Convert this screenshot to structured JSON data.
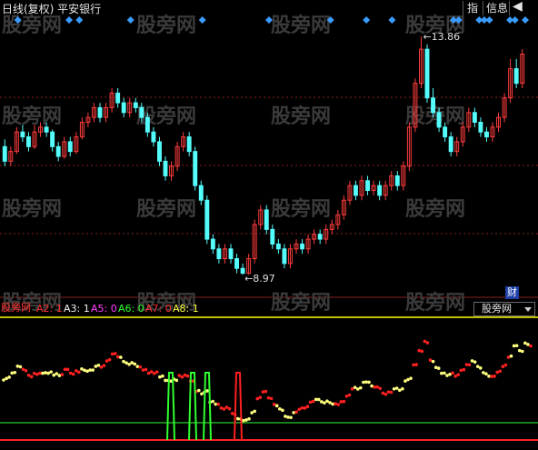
{
  "title": "日线(复权)  平安银行",
  "toolbar": {
    "zhi": "指",
    "xinxi": "信息",
    "back": "◀"
  },
  "watermark": "股旁网",
  "cai_badge": "财",
  "indicator": {
    "name": "股旁网",
    "selector": "股旁网",
    "labels": [
      {
        "key": "A2",
        "value": "1",
        "color": "#ff3030"
      },
      {
        "key": "A3",
        "value": "1",
        "color": "#f2f2f2"
      },
      {
        "key": "A5",
        "value": "0",
        "color": "#ff40ff"
      },
      {
        "key": "A6",
        "value": "0",
        "color": "#30ff30"
      },
      {
        "key": "A7",
        "value": "0",
        "color": "#ff3030"
      },
      {
        "key": "A8",
        "value": "1",
        "color": "#ffff40"
      }
    ]
  },
  "colors": {
    "up": "#ff3c3c",
    "down": "#54fcfc",
    "grid": "#8a1f1f",
    "diamond": "#3a9cff",
    "yellow_line": "#ffff00",
    "red_line": "#ff2020",
    "green_spike": "#30ff30",
    "red_spike": "#ff2020",
    "dot_red": "#ff2020",
    "dot_yellow": "#ffff80"
  },
  "chart_data": {
    "type": "candlestick",
    "high_label": "13.86",
    "low_label": "8.97",
    "high_value": 13.86,
    "low_value": 8.97,
    "price_range": [
      8.6,
      14.2
    ],
    "candles": [
      [
        11.6,
        11.3,
        11.75,
        11.2
      ],
      [
        11.3,
        11.5,
        11.6,
        11.2
      ],
      [
        11.5,
        11.9,
        12.0,
        11.45
      ],
      [
        11.9,
        11.8,
        12.05,
        11.7
      ],
      [
        11.8,
        11.6,
        11.9,
        11.5
      ],
      [
        11.6,
        11.9,
        12.05,
        11.55
      ],
      [
        11.9,
        12.0,
        12.1,
        11.8
      ],
      [
        12.0,
        11.9,
        12.1,
        11.8
      ],
      [
        11.9,
        11.6,
        11.95,
        11.5
      ],
      [
        11.6,
        11.4,
        11.7,
        11.3
      ],
      [
        11.4,
        11.7,
        11.8,
        11.35
      ],
      [
        11.7,
        11.5,
        11.8,
        11.4
      ],
      [
        11.5,
        11.8,
        11.9,
        11.45
      ],
      [
        11.8,
        12.1,
        12.2,
        11.75
      ],
      [
        12.1,
        12.2,
        12.3,
        12.0
      ],
      [
        12.2,
        12.4,
        12.5,
        12.1
      ],
      [
        12.4,
        12.2,
        12.5,
        12.1
      ],
      [
        12.2,
        12.4,
        12.5,
        12.1
      ],
      [
        12.4,
        12.7,
        12.8,
        12.3
      ],
      [
        12.7,
        12.5,
        12.8,
        12.4
      ],
      [
        12.5,
        12.3,
        12.6,
        12.2
      ],
      [
        12.3,
        12.5,
        12.6,
        12.2
      ],
      [
        12.5,
        12.4,
        12.6,
        12.3
      ],
      [
        12.4,
        12.2,
        12.5,
        12.1
      ],
      [
        12.2,
        11.9,
        12.3,
        11.8
      ],
      [
        11.9,
        11.7,
        12.0,
        11.6
      ],
      [
        11.7,
        11.3,
        11.8,
        11.2
      ],
      [
        11.3,
        11.0,
        11.4,
        10.9
      ],
      [
        11.0,
        11.2,
        11.3,
        10.9
      ],
      [
        11.2,
        11.6,
        11.7,
        11.1
      ],
      [
        11.6,
        11.8,
        11.9,
        11.5
      ],
      [
        11.8,
        11.5,
        11.9,
        11.4
      ],
      [
        11.5,
        10.8,
        11.6,
        10.7
      ],
      [
        10.8,
        10.5,
        10.9,
        10.4
      ],
      [
        10.5,
        9.7,
        10.6,
        9.6
      ],
      [
        9.7,
        9.5,
        9.8,
        9.4
      ],
      [
        9.5,
        9.3,
        9.6,
        9.2
      ],
      [
        9.3,
        9.5,
        9.6,
        9.2
      ],
      [
        9.5,
        9.3,
        9.6,
        9.2
      ],
      [
        9.3,
        9.1,
        9.4,
        9.0
      ],
      [
        9.1,
        9.0,
        9.2,
        8.97
      ],
      [
        9.0,
        9.3,
        9.4,
        8.97
      ],
      [
        9.3,
        10.0,
        10.1,
        9.2
      ],
      [
        10.0,
        10.3,
        10.4,
        9.9
      ],
      [
        10.3,
        9.9,
        10.4,
        9.8
      ],
      [
        9.9,
        9.6,
        10.0,
        9.5
      ],
      [
        9.6,
        9.5,
        9.7,
        9.4
      ],
      [
        9.5,
        9.2,
        9.6,
        9.1
      ],
      [
        9.2,
        9.5,
        9.6,
        9.1
      ],
      [
        9.5,
        9.6,
        9.7,
        9.4
      ],
      [
        9.6,
        9.5,
        9.7,
        9.4
      ],
      [
        9.5,
        9.7,
        9.8,
        9.4
      ],
      [
        9.7,
        9.8,
        9.9,
        9.6
      ],
      [
        9.8,
        9.7,
        9.9,
        9.6
      ],
      [
        9.7,
        9.9,
        10.0,
        9.6
      ],
      [
        9.9,
        10.0,
        10.1,
        9.8
      ],
      [
        10.0,
        10.2,
        10.3,
        9.9
      ],
      [
        10.2,
        10.5,
        10.6,
        10.1
      ],
      [
        10.5,
        10.8,
        10.9,
        10.4
      ],
      [
        10.8,
        10.6,
        10.9,
        10.5
      ],
      [
        10.6,
        10.9,
        11.0,
        10.5
      ],
      [
        10.9,
        10.7,
        11.0,
        10.6
      ],
      [
        10.7,
        10.8,
        10.9,
        10.6
      ],
      [
        10.8,
        10.6,
        10.9,
        10.5
      ],
      [
        10.6,
        10.8,
        10.9,
        10.5
      ],
      [
        10.8,
        11.0,
        11.1,
        10.7
      ],
      [
        11.0,
        10.8,
        11.1,
        10.7
      ],
      [
        10.8,
        11.2,
        11.3,
        10.7
      ],
      [
        11.2,
        12.0,
        12.1,
        11.1
      ],
      [
        12.0,
        12.9,
        13.0,
        11.9
      ],
      [
        12.9,
        13.6,
        13.86,
        12.8
      ],
      [
        13.6,
        12.6,
        13.7,
        12.5
      ],
      [
        12.6,
        12.3,
        12.8,
        12.2
      ],
      [
        12.3,
        12.0,
        12.4,
        11.9
      ],
      [
        12.0,
        11.8,
        12.1,
        11.7
      ],
      [
        11.8,
        11.5,
        11.9,
        11.4
      ],
      [
        11.5,
        11.7,
        11.8,
        11.4
      ],
      [
        11.7,
        12.0,
        12.1,
        11.6
      ],
      [
        12.0,
        12.3,
        12.4,
        11.9
      ],
      [
        12.3,
        12.1,
        12.4,
        12.0
      ],
      [
        12.1,
        11.9,
        12.2,
        11.8
      ],
      [
        11.9,
        11.8,
        12.0,
        11.7
      ],
      [
        11.8,
        12.0,
        12.1,
        11.7
      ],
      [
        12.0,
        12.2,
        12.3,
        11.9
      ],
      [
        12.2,
        12.6,
        12.7,
        12.1
      ],
      [
        12.6,
        13.2,
        13.4,
        12.5
      ],
      [
        13.2,
        12.9,
        13.4,
        12.8
      ],
      [
        12.9,
        13.5,
        13.6,
        12.8
      ]
    ],
    "diamonds_x_rel": [
      0.01,
      0.11,
      0.13,
      0.23,
      0.37,
      0.5,
      0.62,
      0.69,
      0.74,
      0.86,
      0.87,
      0.91,
      0.92,
      0.93,
      0.97,
      0.98,
      1.0
    ]
  }
}
